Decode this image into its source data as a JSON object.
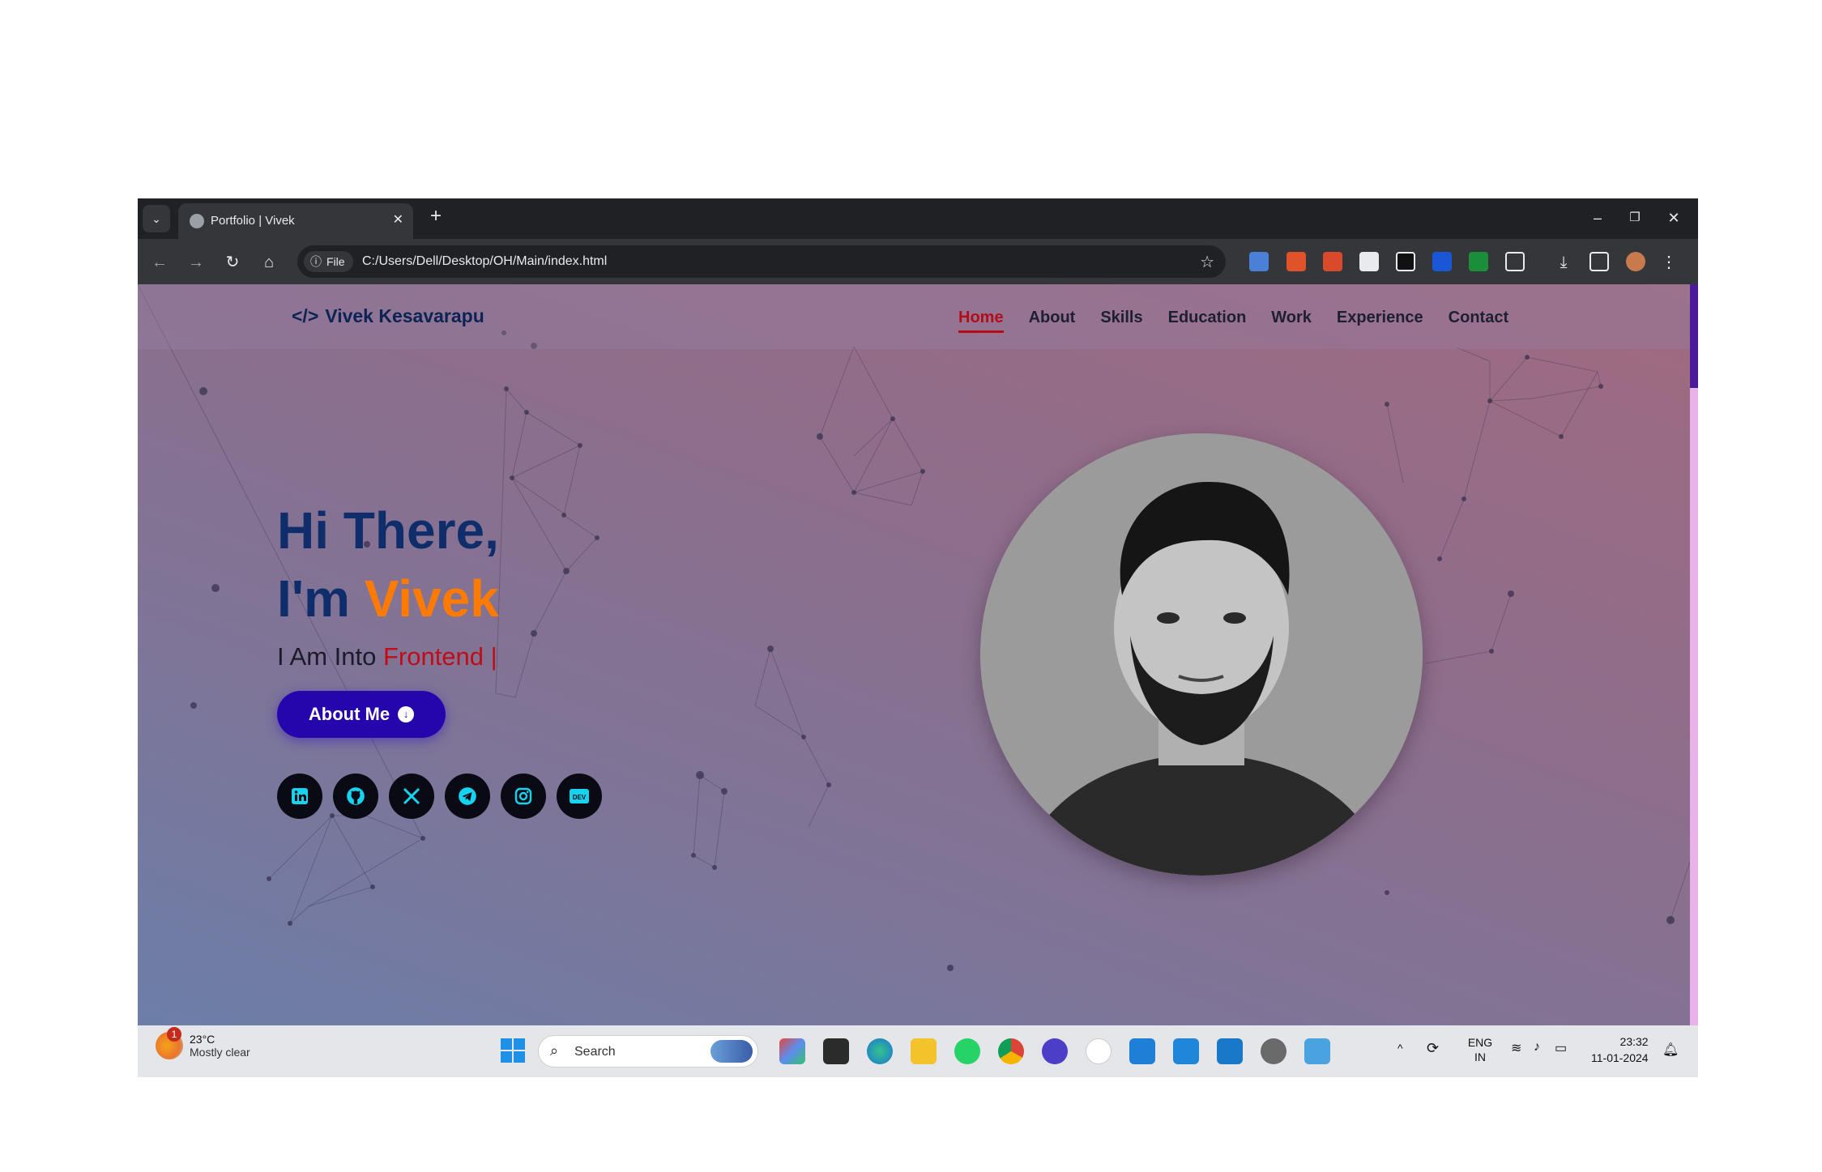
{
  "browser": {
    "tab_title": "Portfolio | Vivek",
    "file_chip": "File",
    "url": "C:/Users/Dell/Desktop/OH/Main/index.html"
  },
  "site": {
    "logo_text": "Vivek Kesavarapu",
    "logo_icon": "</>",
    "nav": [
      "Home",
      "About",
      "Skills",
      "Education",
      "Work",
      "Experience",
      "Contact"
    ],
    "active_nav": "Home",
    "hero_line1": "Hi There,",
    "hero_line2_prefix": "I'm ",
    "hero_name": "Vivek",
    "tagline_prefix": "I Am Into ",
    "tagline_role": "Frontend |",
    "about_button": "About Me",
    "socials": [
      "linkedin-icon",
      "github-icon",
      "x-icon",
      "telegram-icon",
      "instagram-icon",
      "dev-icon"
    ],
    "dev_badge": "DEV"
  },
  "taskbar": {
    "weather_badge": "1",
    "weather_temp": "23°C",
    "weather_cond": "Mostly clear",
    "search_label": "Search",
    "lang_line1": "ENG",
    "lang_line2": "IN",
    "time": "23:32",
    "date": "11-01-2024"
  },
  "colors": {
    "accent_orange": "#ff7a00",
    "heading_navy": "#0f2d6b",
    "nav_active": "#b10e1a",
    "button_blue": "#2506ad"
  }
}
